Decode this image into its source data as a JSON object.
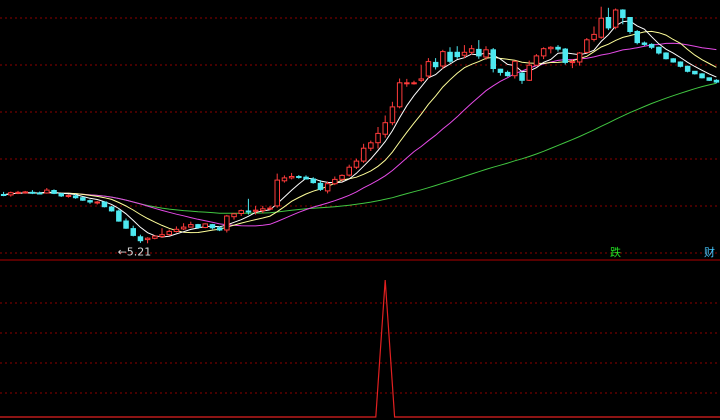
{
  "chart_data": [
    {
      "type": "candlestick",
      "annotations": {
        "low_label": "←5.21",
        "tag_fall": "跌",
        "tag_fin": "财"
      },
      "candles": [
        [
          6.62,
          6.69,
          6.57,
          6.61
        ],
        [
          6.61,
          6.7,
          6.56,
          6.67
        ],
        [
          6.66,
          6.72,
          6.63,
          6.68
        ],
        [
          6.67,
          6.72,
          6.64,
          6.69
        ],
        [
          6.68,
          6.74,
          6.63,
          6.66
        ],
        [
          6.66,
          6.7,
          6.62,
          6.64
        ],
        [
          6.66,
          6.8,
          6.64,
          6.74
        ],
        [
          6.73,
          6.76,
          6.63,
          6.65
        ],
        [
          6.64,
          6.66,
          6.55,
          6.58
        ],
        [
          6.58,
          6.62,
          6.53,
          6.59
        ],
        [
          6.58,
          6.63,
          6.5,
          6.53
        ],
        [
          6.53,
          6.56,
          6.44,
          6.46
        ],
        [
          6.45,
          6.48,
          6.36,
          6.41
        ],
        [
          6.4,
          6.44,
          6.34,
          6.41
        ],
        [
          6.41,
          6.43,
          6.26,
          6.28
        ],
        [
          6.27,
          6.3,
          6.14,
          6.16
        ],
        [
          6.16,
          6.2,
          5.86,
          5.88
        ],
        [
          5.88,
          5.95,
          5.66,
          5.68
        ],
        [
          5.67,
          5.75,
          5.45,
          5.48
        ],
        [
          5.44,
          5.5,
          5.27,
          5.33
        ],
        [
          5.36,
          5.43,
          5.26,
          5.4
        ],
        [
          5.4,
          5.48,
          5.37,
          5.46
        ],
        [
          5.45,
          5.68,
          5.41,
          5.5
        ],
        [
          5.5,
          5.64,
          5.47,
          5.59
        ],
        [
          5.59,
          5.73,
          5.56,
          5.65
        ],
        [
          5.66,
          5.82,
          5.63,
          5.71
        ],
        [
          5.71,
          5.86,
          5.7,
          5.78
        ],
        [
          5.78,
          5.8,
          5.66,
          5.7
        ],
        [
          5.7,
          5.82,
          5.68,
          5.8
        ],
        [
          5.78,
          5.8,
          5.65,
          5.69
        ],
        [
          5.69,
          5.73,
          5.6,
          5.63
        ],
        [
          5.63,
          6.05,
          5.56,
          6.02
        ],
        [
          6.0,
          6.1,
          5.92,
          6.08
        ],
        [
          6.09,
          6.2,
          6.02,
          6.17
        ],
        [
          6.16,
          6.5,
          6.06,
          6.15
        ],
        [
          6.15,
          6.3,
          6.06,
          6.18
        ],
        [
          6.17,
          6.3,
          6.1,
          6.22
        ],
        [
          6.22,
          6.3,
          6.18,
          6.24
        ],
        [
          6.3,
          7.2,
          6.25,
          7.02
        ],
        [
          7.0,
          7.15,
          6.95,
          7.08
        ],
        [
          7.08,
          7.22,
          7.04,
          7.12
        ],
        [
          7.12,
          7.16,
          7.06,
          7.1
        ],
        [
          7.1,
          7.15,
          7.04,
          7.05
        ],
        [
          7.05,
          7.1,
          6.92,
          6.95
        ],
        [
          6.93,
          7.02,
          6.72,
          6.76
        ],
        [
          6.72,
          6.98,
          6.65,
          6.92
        ],
        [
          6.92,
          7.12,
          6.88,
          7.04
        ],
        [
          7.04,
          7.18,
          6.98,
          7.15
        ],
        [
          7.16,
          7.45,
          7.12,
          7.38
        ],
        [
          7.38,
          7.62,
          7.33,
          7.55
        ],
        [
          7.55,
          8.03,
          7.5,
          7.91
        ],
        [
          7.91,
          8.12,
          7.83,
          8.06
        ],
        [
          8.06,
          8.5,
          7.9,
          8.32
        ],
        [
          8.3,
          8.82,
          8.2,
          8.62
        ],
        [
          8.62,
          9.2,
          8.55,
          9.06
        ],
        [
          9.06,
          9.85,
          9.02,
          9.73
        ],
        [
          9.73,
          9.84,
          9.62,
          9.73
        ],
        [
          9.73,
          9.79,
          9.68,
          9.73
        ],
        [
          9.8,
          10.22,
          9.75,
          9.84
        ],
        [
          9.92,
          10.42,
          9.85,
          10.32
        ],
        [
          10.3,
          10.42,
          10.1,
          10.18
        ],
        [
          10.2,
          10.65,
          10.12,
          10.6
        ],
        [
          10.58,
          10.72,
          10.28,
          10.33
        ],
        [
          10.58,
          10.75,
          10.4,
          10.46
        ],
        [
          10.5,
          10.78,
          10.42,
          10.58
        ],
        [
          10.58,
          10.78,
          10.52,
          10.68
        ],
        [
          10.66,
          10.92,
          10.4,
          10.48
        ],
        [
          10.45,
          10.75,
          10.37,
          10.65
        ],
        [
          10.65,
          10.7,
          10.02,
          10.13
        ],
        [
          10.11,
          10.12,
          9.93,
          10.02
        ],
        [
          10.02,
          10.07,
          9.9,
          9.93
        ],
        [
          9.93,
          10.34,
          9.85,
          10.33
        ],
        [
          10.0,
          10.03,
          9.7,
          9.8
        ],
        [
          9.8,
          10.35,
          9.78,
          10.22
        ],
        [
          10.22,
          10.53,
          10.2,
          10.48
        ],
        [
          10.48,
          10.72,
          10.39,
          10.68
        ],
        [
          10.68,
          10.75,
          10.55,
          10.72
        ],
        [
          10.72,
          10.78,
          10.6,
          10.67
        ],
        [
          10.67,
          10.7,
          10.24,
          10.3
        ],
        [
          10.3,
          10.39,
          10.14,
          10.32
        ],
        [
          10.31,
          10.59,
          10.21,
          10.56
        ],
        [
          10.58,
          10.98,
          10.56,
          10.93
        ],
        [
          10.94,
          11.3,
          10.88,
          11.08
        ],
        [
          11.0,
          11.85,
          10.96,
          11.53
        ],
        [
          11.55,
          11.82,
          11.2,
          11.26
        ],
        [
          11.28,
          11.8,
          11.22,
          11.76
        ],
        [
          11.76,
          11.78,
          11.36,
          11.55
        ],
        [
          11.55,
          11.52,
          11.1,
          11.16
        ],
        [
          11.16,
          11.2,
          10.8,
          10.85
        ],
        [
          10.84,
          10.88,
          10.76,
          10.8
        ],
        [
          10.8,
          10.83,
          10.67,
          10.72
        ],
        [
          10.72,
          10.74,
          10.52,
          10.56
        ],
        [
          10.56,
          10.58,
          10.38,
          10.4
        ],
        [
          10.4,
          10.42,
          10.29,
          10.31
        ],
        [
          10.31,
          10.33,
          10.16,
          10.19
        ],
        [
          10.19,
          10.21,
          10.02,
          10.05
        ],
        [
          10.05,
          10.06,
          9.96,
          9.98
        ],
        [
          9.98,
          10.0,
          9.85,
          9.87
        ],
        [
          9.87,
          9.88,
          9.78,
          9.8
        ],
        [
          9.8,
          9.83,
          9.72,
          9.75
        ]
      ]
    },
    {
      "type": "line",
      "series": [
        {
          "values": [
            0,
            0,
            0,
            0,
            0,
            0,
            0,
            0,
            0,
            0,
            0,
            0,
            0,
            0,
            0,
            0,
            0,
            0,
            0,
            0,
            0,
            0,
            0,
            0,
            0,
            0,
            0,
            0,
            0,
            0,
            0,
            0,
            0,
            0,
            0,
            0,
            0,
            0,
            0,
            0,
            0,
            0,
            0,
            0,
            0,
            0,
            0,
            0,
            0,
            0,
            0,
            0,
            0,
            1,
            0,
            0,
            0,
            0,
            0,
            0,
            0,
            0,
            0,
            0,
            0,
            0,
            0,
            0,
            0,
            0,
            0,
            0,
            0,
            0,
            0,
            0,
            0,
            0,
            0,
            0,
            0,
            0,
            0,
            0,
            0,
            0,
            0,
            0,
            0,
            0,
            0,
            0,
            0,
            0,
            0,
            0,
            0,
            0,
            0,
            0
          ]
        }
      ]
    }
  ],
  "colors": {
    "background": "#000000",
    "grid": "#8b0000",
    "divider": "#b00000",
    "up": "#ff3b3b",
    "down": "#4de8f0",
    "ma_fast": "#ffffff",
    "ma_mid": "#ffff9a",
    "ma_slow": "#e44ae6",
    "ma_long": "#41c641",
    "signal": "#e12020",
    "low_label": "#d8d8d8",
    "tag_fall": "#22e022",
    "tag_fin": "#45c7ff"
  }
}
